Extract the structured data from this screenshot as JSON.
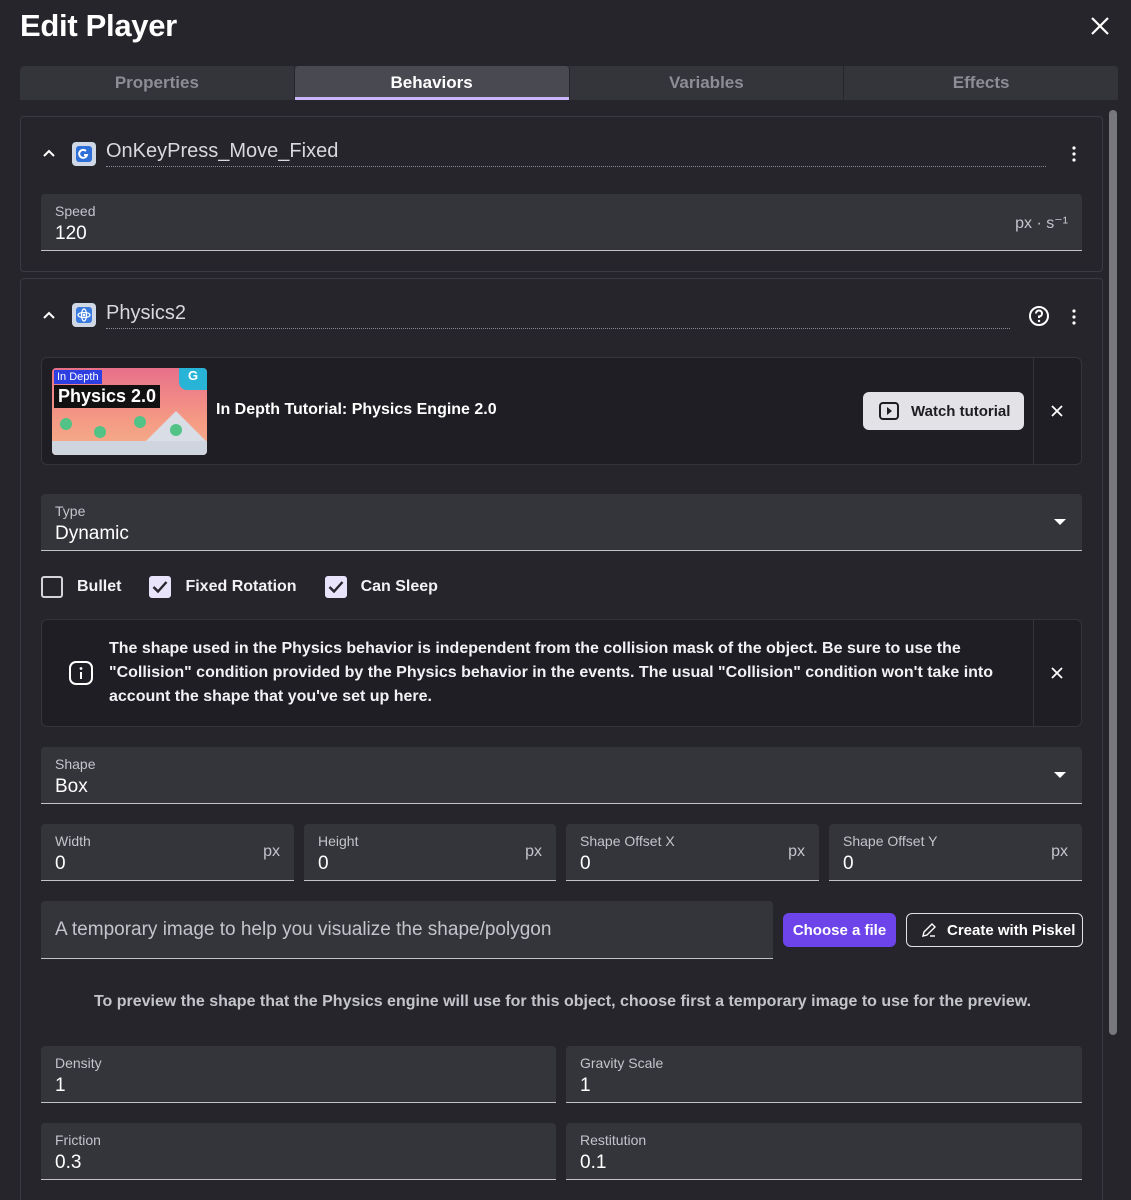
{
  "dialog": {
    "title": "Edit Player"
  },
  "tabs": [
    {
      "label": "Properties"
    },
    {
      "label": "Behaviors"
    },
    {
      "label": "Variables"
    },
    {
      "label": "Effects"
    }
  ],
  "behavior1": {
    "name": "OnKeyPress_Move_Fixed",
    "speed": {
      "label": "Speed",
      "value": "120",
      "unit": "px · s⁻¹"
    }
  },
  "behavior2": {
    "name": "Physics2",
    "tutorial": {
      "thumb_badge": "In Depth",
      "thumb_title": "Physics 2.0",
      "title": "In Depth Tutorial: Physics Engine 2.0",
      "watch_label": "Watch tutorial"
    },
    "type": {
      "label": "Type",
      "value": "Dynamic"
    },
    "checkboxes": [
      {
        "label": "Bullet",
        "checked": false
      },
      {
        "label": "Fixed Rotation",
        "checked": true
      },
      {
        "label": "Can Sleep",
        "checked": true
      }
    ],
    "info": "The shape used in the Physics behavior is independent from the collision mask of the object. Be sure to use the \"Collision\" condition provided by the Physics behavior in the events. The usual \"Collision\" condition won't take into account the shape that you've set up here.",
    "shape": {
      "label": "Shape",
      "value": "Box"
    },
    "dims": [
      {
        "label": "Width",
        "value": "0",
        "unit": "px"
      },
      {
        "label": "Height",
        "value": "0",
        "unit": "px"
      },
      {
        "label": "Shape Offset X",
        "value": "0",
        "unit": "px"
      },
      {
        "label": "Shape Offset Y",
        "value": "0",
        "unit": "px"
      }
    ],
    "image_placeholder": "A temporary image to help you visualize the shape/polygon",
    "choose_file_label": "Choose a file",
    "piskel_label": "Create with Piskel",
    "preview_note": "To preview the shape that the Physics engine will use for this object, choose first a temporary image to use for the preview.",
    "density": {
      "label": "Density",
      "value": "1"
    },
    "gravity_scale": {
      "label": "Gravity Scale",
      "value": "1"
    },
    "friction": {
      "label": "Friction",
      "value": "0.3"
    },
    "restitution": {
      "label": "Restitution",
      "value": "0.1"
    }
  },
  "colors": {
    "accent": "#6d44e9",
    "tab_underline": "#c9b6fc",
    "background": "#25252b",
    "field": "#34343b"
  }
}
